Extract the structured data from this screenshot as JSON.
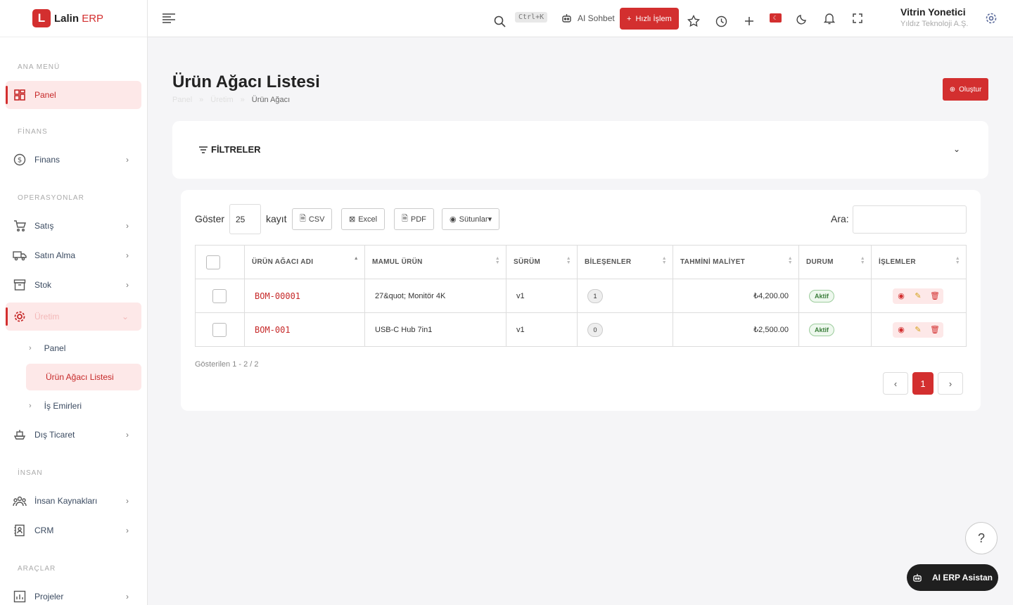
{
  "app": {
    "logo_letter": "L",
    "name": "Lalin",
    "suffix": "ERP"
  },
  "sidebar": {
    "sections": [
      "ANA MENÜ",
      "FİNANS",
      "OPERASYONLAR",
      "İNSAN",
      "ARAÇLAR"
    ],
    "items": {
      "panel": "Panel",
      "finans": "Finans",
      "satis": "Satış",
      "satin_alma": "Satın Alma",
      "stok": "Stok",
      "uretim": "Üretim",
      "dis_ticaret": "Dış Ticaret",
      "insan_kaynaklari": "İnsan Kaynakları",
      "crm": "CRM",
      "projeler": "Projeler"
    },
    "sub_items": [
      "Panel",
      "Ürün Ağacı Listesi",
      "İş Emirleri"
    ]
  },
  "header": {
    "shortcut": "Ctrl+K",
    "ai_chat": "AI Sohbet",
    "quick_action": "Hızlı İşlem",
    "user_name": "Vitrin Yonetici",
    "company": "Yıldız Teknoloji A.Ş."
  },
  "page": {
    "title": "Ürün Ağacı Listesi",
    "breadcrumb": [
      "Panel",
      "Üretim",
      "Ürün Ağacı"
    ],
    "create_label": "Oluştur",
    "filters_label": "FİLTRELER"
  },
  "table_toolbar": {
    "show_label": "Göster",
    "page_length": "25",
    "records_label": "kayıt",
    "csv": "CSV",
    "excel": "Excel",
    "pdf": "PDF",
    "columns": "Sütunlar▾",
    "search_label": "Ara:"
  },
  "table": {
    "headers": [
      "ÜRÜN AĞACI ADI",
      "MAMUL ÜRÜN",
      "SÜRÜM",
      "BİLEŞENLER",
      "TAHMİNİ MALİYET",
      "DURUM",
      "İŞLEMLER"
    ],
    "rows": [
      {
        "code": "BOM-00001",
        "product": "27&quot; Monitör 4K",
        "version": "v1",
        "components": "1",
        "cost": "₺4,200.00",
        "status": "Aktif"
      },
      {
        "code": "BOM-001",
        "product": "USB-C Hub 7in1",
        "version": "v1",
        "components": "0",
        "cost": "₺2,500.00",
        "status": "Aktif"
      }
    ]
  },
  "pagination": {
    "info": "Gösterilen 1 - 2 / 2",
    "current": "1"
  },
  "floating": {
    "ai_assistant": "AI ERP Asistan"
  },
  "colors": {
    "accent": "#d32f2f",
    "active_bg": "#fde8e8"
  }
}
